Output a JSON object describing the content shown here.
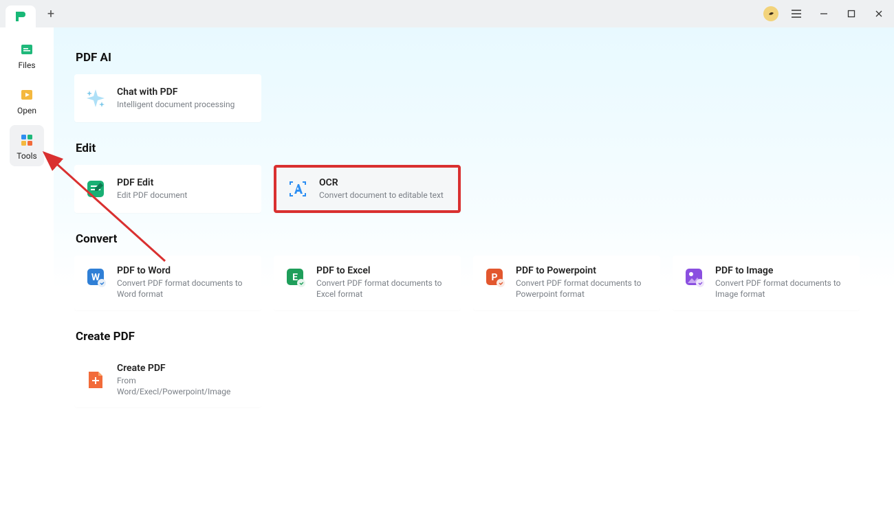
{
  "titlebar": {
    "new_tab_tooltip": "+"
  },
  "sidebar": {
    "items": [
      {
        "label": "Files"
      },
      {
        "label": "Open"
      },
      {
        "label": "Tools"
      }
    ]
  },
  "sections": {
    "pdf_ai": {
      "title": "PDF AI",
      "chat_with_pdf": {
        "title": "Chat with PDF",
        "desc": "Intelligent document processing"
      }
    },
    "edit": {
      "title": "Edit",
      "pdf_edit": {
        "title": "PDF Edit",
        "desc": "Edit PDF document"
      },
      "ocr": {
        "title": "OCR",
        "desc": "Convert document to editable text"
      }
    },
    "convert": {
      "title": "Convert",
      "word": {
        "title": "PDF to Word",
        "desc": "Convert PDF format documents to Word format"
      },
      "excel": {
        "title": "PDF to Excel",
        "desc": "Convert PDF format documents to Excel format"
      },
      "ppt": {
        "title": "PDF to Powerpoint",
        "desc": "Convert PDF format documents to Powerpoint format"
      },
      "image": {
        "title": "PDF to Image",
        "desc": "Convert PDF format documents to Image format"
      }
    },
    "create": {
      "title": "Create PDF",
      "create_pdf": {
        "title": "Create PDF",
        "desc": "From Word/Execl/Powerpoint/Image"
      }
    }
  }
}
